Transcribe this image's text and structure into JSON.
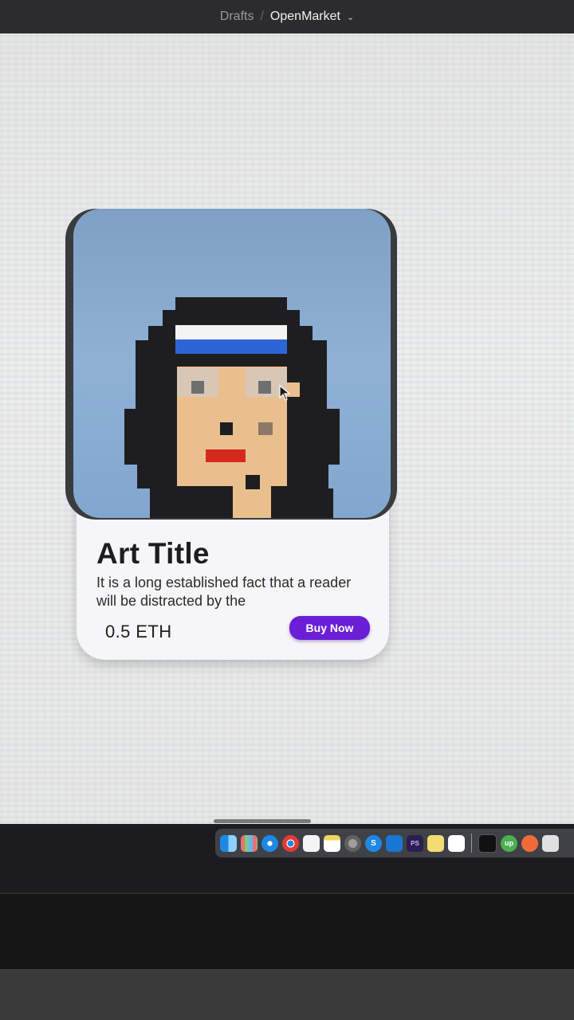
{
  "breadcrumb": {
    "parent": "Drafts",
    "separator": "/",
    "current": "OpenMarket",
    "dropdown_icon": "chevron-down-icon"
  },
  "card": {
    "title": "Art Title",
    "description": "It is a long established fact that a reader will be distracted by the",
    "price": "0.5 ETH",
    "buy_label": "Buy Now",
    "image": "pixel-art-portrait",
    "colors": {
      "button": "#6a1fd6",
      "card_bg": "#f6f6f8",
      "art_bg": "#8fb1d6"
    }
  },
  "dock": {
    "icons": [
      "finder-icon",
      "launchpad-icon",
      "safari-icon",
      "chrome-icon",
      "reminders-icon",
      "notes-icon",
      "system-preferences-icon",
      "skype-icon",
      "vscode-icon",
      "photoshop-icon",
      "stickies-icon",
      "slack-icon",
      "terminal-icon",
      "upwork-icon",
      "postman-icon",
      "textedit-icon"
    ],
    "labels": {
      "skype": "S",
      "photoshop": "PS",
      "upwork": "up"
    }
  }
}
